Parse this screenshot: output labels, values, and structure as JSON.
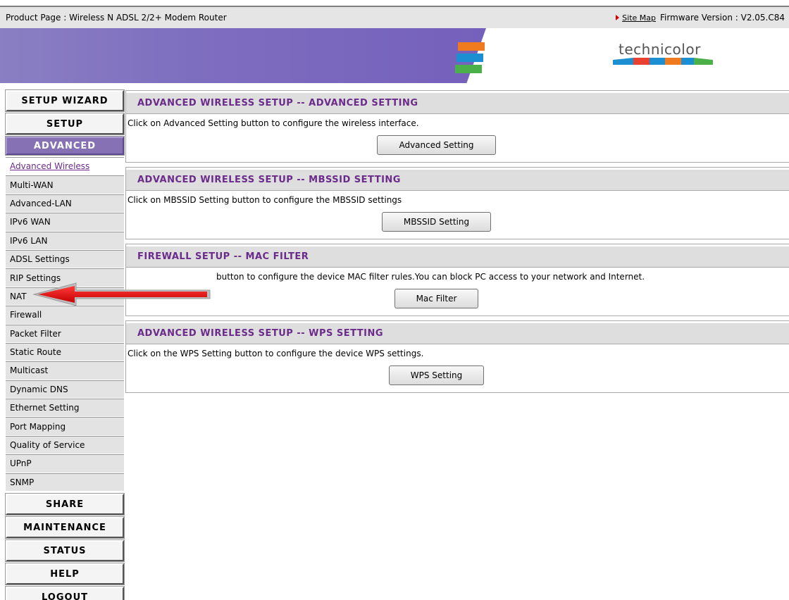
{
  "header": {
    "product_page": "Product Page : Wireless N ADSL 2/2+ Modem Router",
    "site_map": "Site Map",
    "firmware": "Firmware Version : V2.05.C84"
  },
  "brand": {
    "name": "technicolor"
  },
  "nav": {
    "setup_wizard": "SETUP WIZARD",
    "setup": "SETUP",
    "advanced": "ADVANCED",
    "sub_items": [
      "Advanced Wireless",
      "Multi-WAN",
      "Advanced-LAN",
      "IPv6 WAN",
      "IPv6 LAN",
      "ADSL Settings",
      "RIP Settings",
      "NAT",
      "Firewall",
      "Packet Filter",
      "Static Route",
      "Multicast",
      "Dynamic DNS",
      "Ethernet Setting",
      "Port Mapping",
      "Quality of Service",
      "UPnP",
      "SNMP"
    ],
    "share": "SHARE",
    "maintenance": "MAINTENANCE",
    "status": "STATUS",
    "help": "HELP",
    "logout": "LOGOUT"
  },
  "sections": [
    {
      "title": "ADVANCED WIRELESS SETUP -- ADVANCED SETTING",
      "text": "Click on Advanced Setting button to configure the wireless interface.",
      "button": "Advanced Setting"
    },
    {
      "title": "ADVANCED WIRELESS SETUP -- MBSSID SETTING",
      "text": "Click on MBSSID Setting button to configure the MBSSID settings",
      "button": "MBSSID Setting"
    },
    {
      "title": "FIREWALL SETUP -- MAC FILTER",
      "text": "button to configure the device MAC filter rules.You can block PC access to your network and Internet.",
      "button": "Mac Filter"
    },
    {
      "title": "ADVANCED WIRELESS SETUP -- WPS SETTING",
      "text": "Click on the WPS Setting button to configure the device WPS settings.",
      "button": "WPS Setting"
    }
  ],
  "colors": {
    "accent": "#6b2b8b",
    "active_nav": "#8571b4",
    "arrow": "#e00000"
  }
}
